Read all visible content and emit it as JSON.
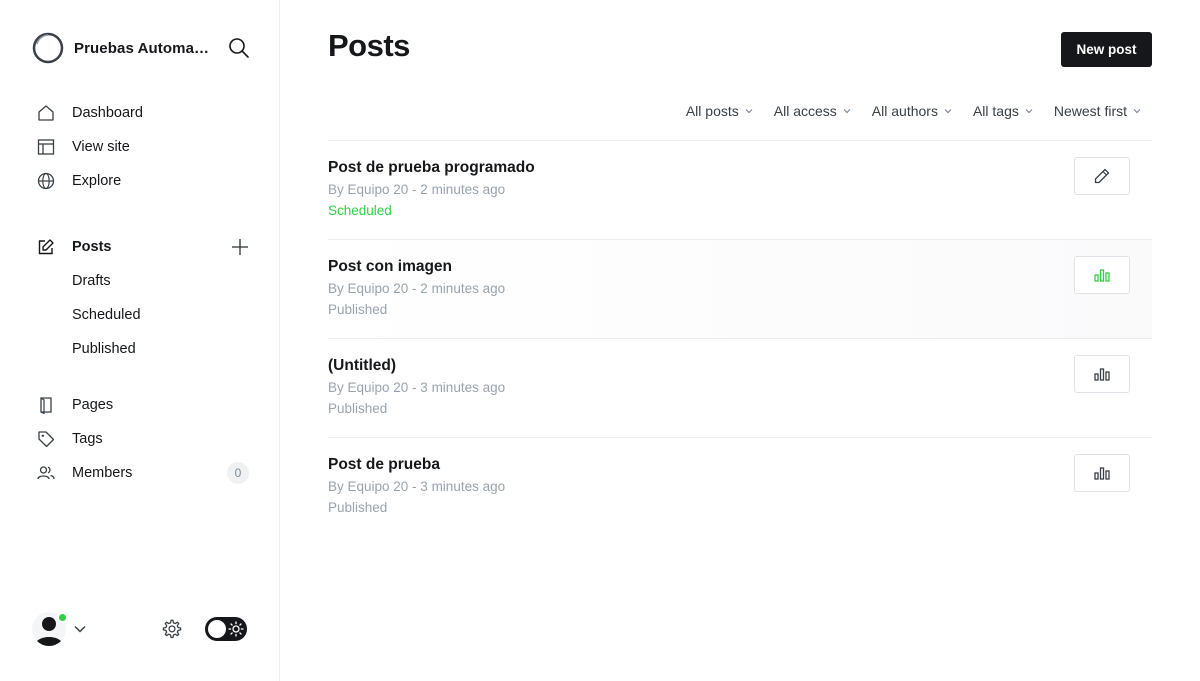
{
  "sidebar": {
    "site_name": "Pruebas Automatizadas",
    "nav_primary": [
      {
        "label": "Dashboard",
        "icon": "home-icon"
      },
      {
        "label": "View site",
        "icon": "layout-icon"
      },
      {
        "label": "Explore",
        "icon": "globe-icon"
      }
    ],
    "posts_label": "Posts",
    "posts_sub": [
      {
        "label": "Drafts"
      },
      {
        "label": "Scheduled"
      },
      {
        "label": "Published"
      }
    ],
    "nav_secondary": [
      {
        "label": "Pages",
        "icon": "page-icon"
      },
      {
        "label": "Tags",
        "icon": "tag-icon"
      },
      {
        "label": "Members",
        "icon": "members-icon",
        "count": "0"
      }
    ]
  },
  "header": {
    "title": "Posts",
    "new_post_label": "New post"
  },
  "filters": [
    "All posts",
    "All access",
    "All authors",
    "All tags",
    "Newest first"
  ],
  "posts": [
    {
      "title": "Post de prueba programado",
      "meta": "By Equipo 20 - 2 minutes ago",
      "status": "Scheduled",
      "action_icon": "pencil-icon"
    },
    {
      "title": "Post con imagen",
      "meta": "By Equipo 20 - 2 minutes ago",
      "status": "Published",
      "action_icon": "analytics-icon"
    },
    {
      "title": "(Untitled)",
      "meta": "By Equipo 20 - 3 minutes ago",
      "status": "Published",
      "action_icon": "analytics-icon"
    },
    {
      "title": "Post de prueba",
      "meta": "By Equipo 20 - 3 minutes ago",
      "status": "Published",
      "action_icon": "analytics-icon"
    }
  ],
  "colors": {
    "accent_green": "#30cf43",
    "text_dark": "#15171a",
    "text_muted": "#99a3ad",
    "border": "#ebeef0"
  }
}
